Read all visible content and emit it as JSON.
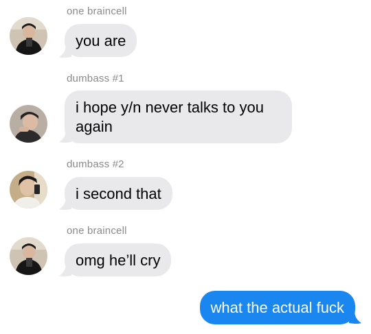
{
  "conversation": {
    "messages": [
      {
        "sender": "one braincell",
        "text": "you are",
        "direction": "incoming"
      },
      {
        "sender": "dumbass #1",
        "text": "i hope y/n never talks to you again",
        "direction": "incoming"
      },
      {
        "sender": "dumbass #2",
        "text": "i second that",
        "direction": "incoming"
      },
      {
        "sender": "one braincell",
        "text": "omg he’ll cry",
        "direction": "incoming"
      },
      {
        "text": "what the actual fuck",
        "direction": "outgoing"
      }
    ]
  },
  "colors": {
    "incoming_bubble": "#e9e9eb",
    "outgoing_bubble": "#1a86f0",
    "sender_label": "#8a8a8e"
  }
}
